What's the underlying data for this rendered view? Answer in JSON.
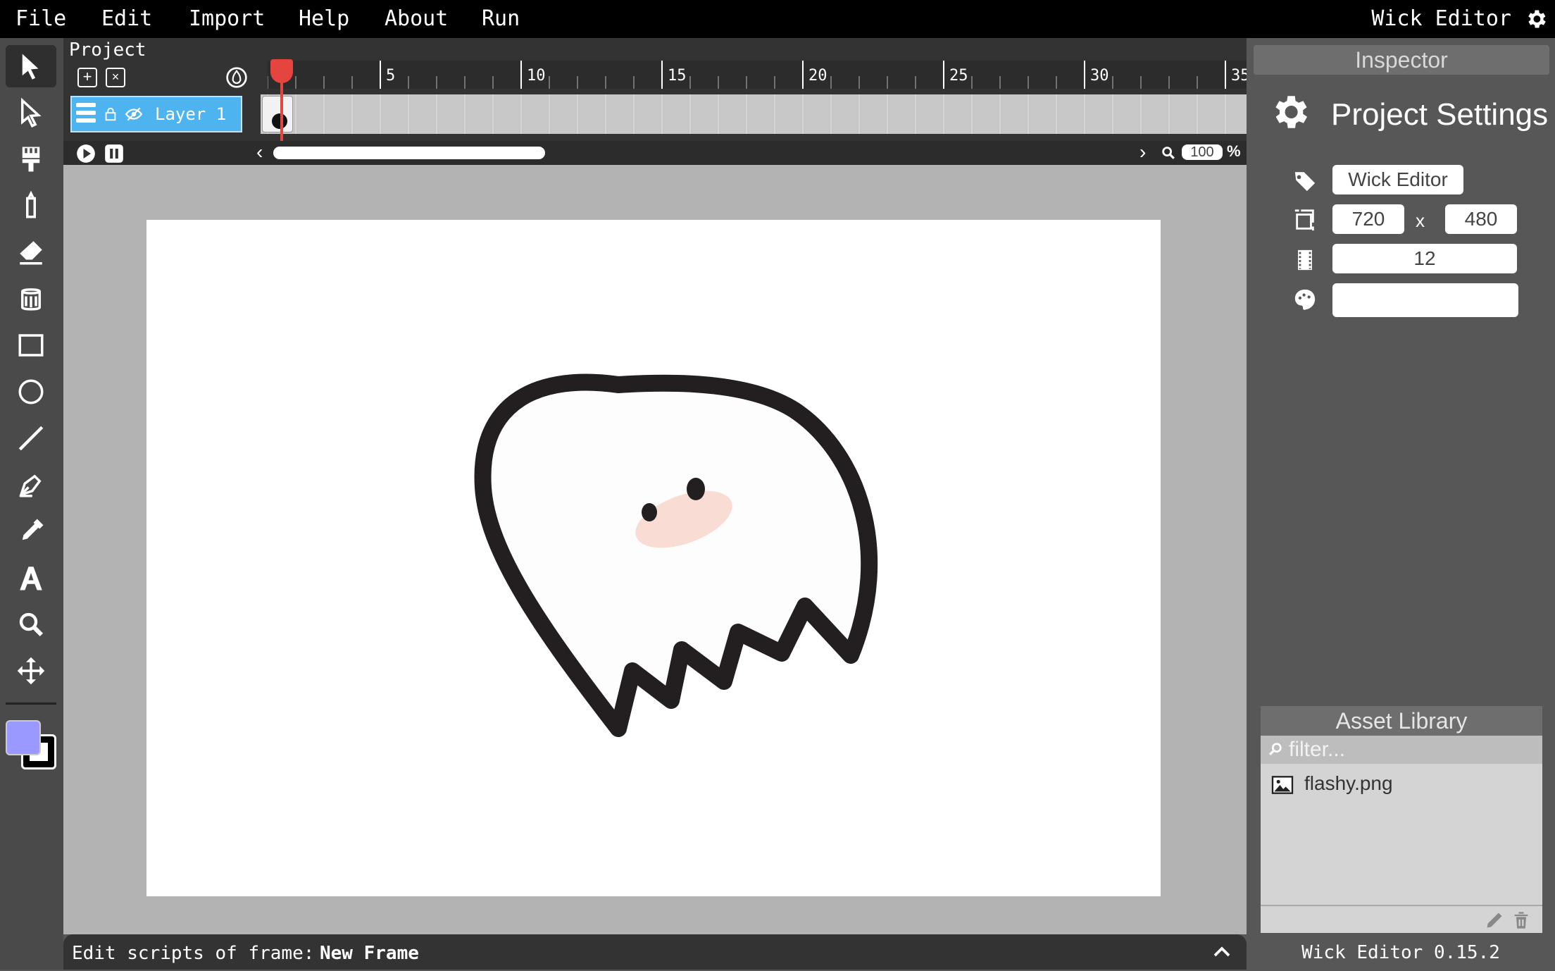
{
  "menubar": {
    "items": [
      "File",
      "Edit",
      "Import",
      "Help",
      "About",
      "Run"
    ],
    "brand": "Wick Editor"
  },
  "toolbar": {
    "tools": [
      "cursor",
      "path-cursor",
      "brush",
      "pencil",
      "eraser",
      "fill-bucket",
      "rectangle",
      "ellipse",
      "line",
      "pen",
      "eyedropper",
      "text",
      "zoom",
      "pan"
    ],
    "selected_tool": "cursor",
    "fill_color": "#9999ff",
    "stroke_color": "#000000"
  },
  "timeline": {
    "project_label": "Project",
    "layer_name": "Layer 1",
    "ruler_labels": [
      "5",
      "10",
      "15",
      "20",
      "25",
      "30",
      "35"
    ],
    "current_frame": 1,
    "zoom_value": "100",
    "zoom_unit": "%"
  },
  "script_bar": {
    "prefix": "Edit scripts of frame:",
    "frame_name": "New Frame"
  },
  "inspector": {
    "title": "Inspector",
    "section_title": "Project Settings",
    "project_name": "Wick Editor",
    "width": "720",
    "x_label": "x",
    "height": "480",
    "framerate": "12",
    "background_color": "#ffffff"
  },
  "asset_library": {
    "title": "Asset Library",
    "filter_placeholder": "filter...",
    "assets": [
      "flashy.png"
    ]
  },
  "footer": {
    "version": "Wick Editor 0.15.2"
  }
}
